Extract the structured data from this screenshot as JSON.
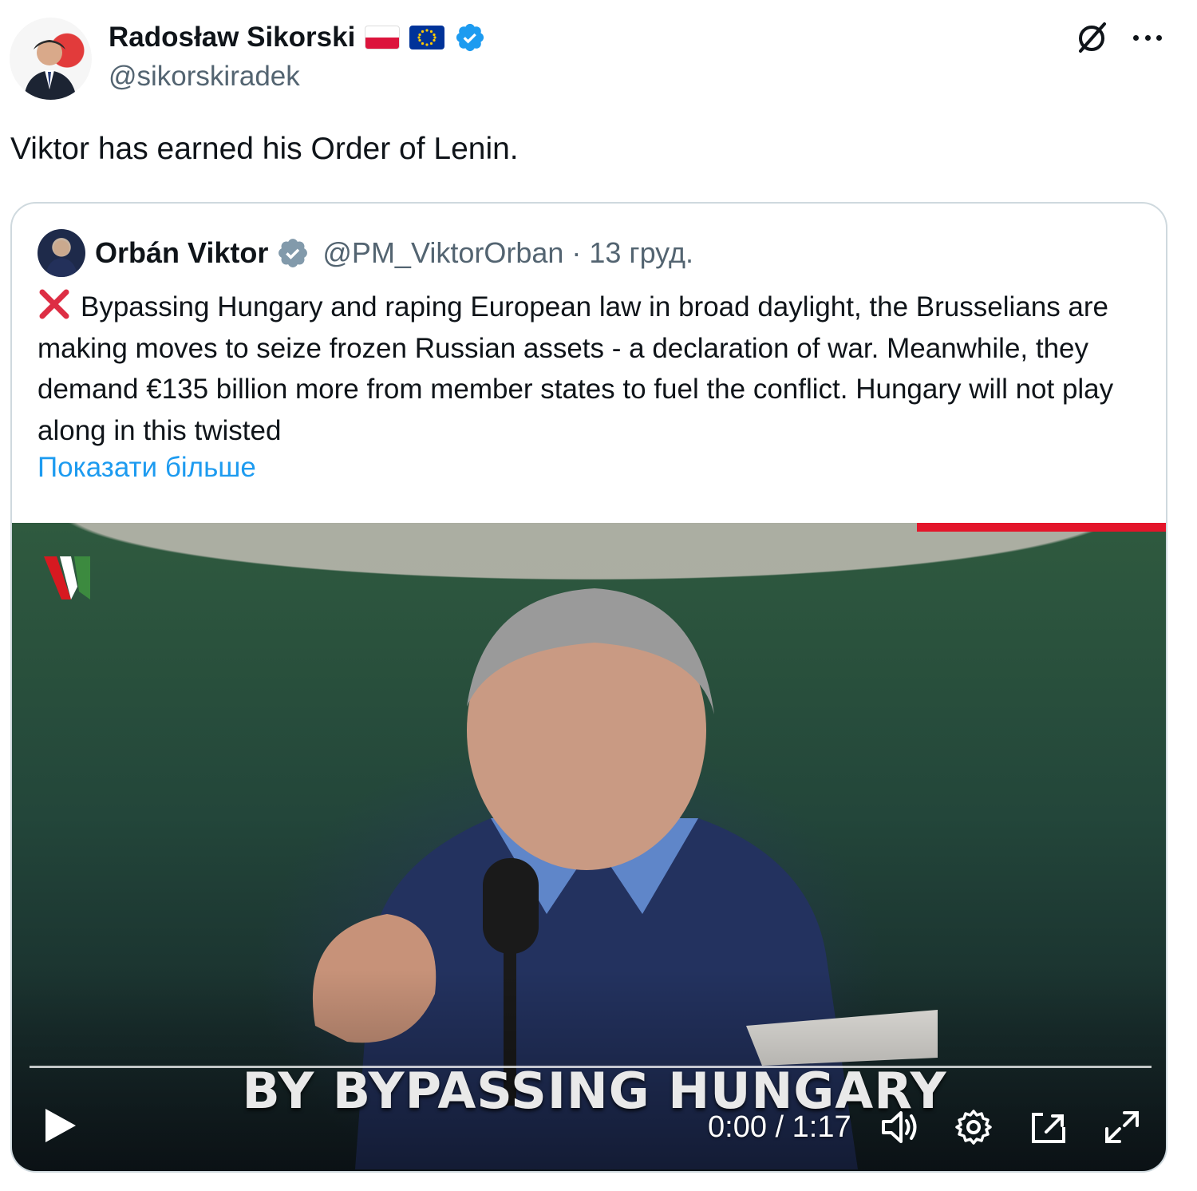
{
  "author": {
    "display_name": "Radosław Sikorski",
    "handle": "@sikorskiradek",
    "flags": [
      "poland-flag",
      "eu-flag"
    ],
    "verified_badge": "verified-badge-icon",
    "avatar": "avatar"
  },
  "header_actions": {
    "grok_icon": "grok-icon",
    "more_icon": "more-options-icon"
  },
  "tweet": {
    "text": "Viktor has earned his Order of Lenin."
  },
  "quoted_tweet": {
    "display_name": "Orbán Viktor",
    "handle": "@PM_ViktorOrban",
    "separator": "·",
    "date": "13 груд.",
    "badge": "government-verified-badge-icon",
    "text": "Bypassing Hungary and raping European law in broad daylight, the Brusselians are making moves to seize frozen Russian assets - a declaration of war. Meanwhile, they demand €135 billion more from member states to fuel the conflict. Hungary will not play along in this twisted",
    "leading_emoji": "cross-mark-icon",
    "show_more": "Показати більше"
  },
  "video": {
    "caption": "BY BYPASSING HUNGARY",
    "current_time": "0:00",
    "duration": "1:17",
    "time_display": "0:00 / 1:17",
    "progress": 0,
    "controls": [
      "play-icon",
      "volume-icon",
      "settings-icon",
      "picture-in-picture-icon",
      "fullscreen-icon"
    ]
  },
  "colors": {
    "link": "#1d9bf0",
    "secondary_text": "#536471",
    "border": "#cfd9de",
    "verified_blue": "#1d9bf0",
    "video_progress_red": "#e3152a"
  }
}
